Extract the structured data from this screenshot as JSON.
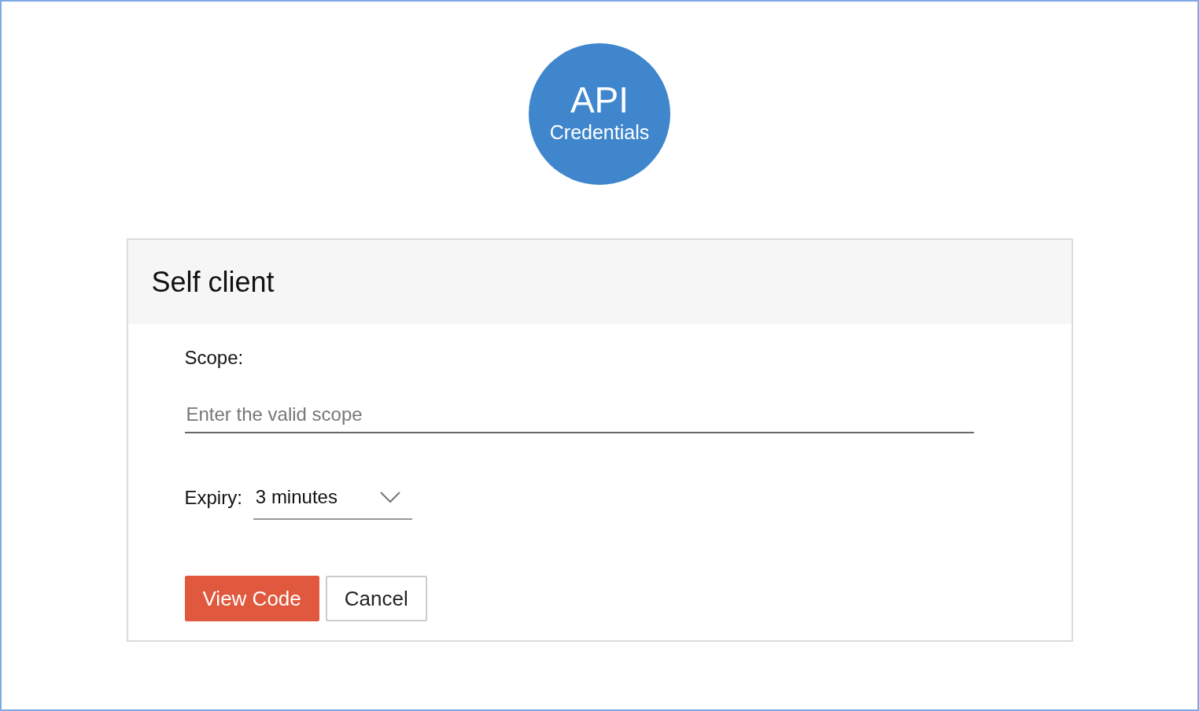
{
  "logo": {
    "title": "API",
    "subtitle": "Credentials"
  },
  "card": {
    "title": "Self client"
  },
  "scope": {
    "label": "Scope:",
    "placeholder": "Enter the valid scope"
  },
  "expiry": {
    "label": "Expiry:",
    "value": "3 minutes"
  },
  "buttons": [
    {
      "label": "View Code",
      "kind": "primary"
    },
    {
      "label": "Cancel",
      "kind": "secondary"
    }
  ]
}
